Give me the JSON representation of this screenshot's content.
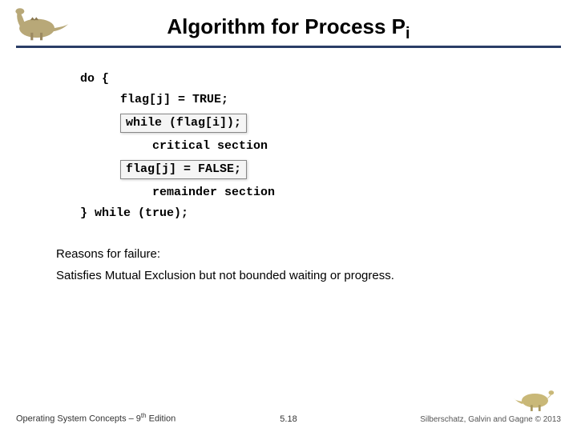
{
  "title_main": "Algorithm for Process P",
  "title_sub": "i",
  "code": {
    "l1": "do {",
    "l2": "flag[j] = TRUE;",
    "l3": "while (flag[i]);",
    "l4": "critical section",
    "l5": "flag[j] = FALSE;",
    "l6": "remainder section",
    "l7": "} while (true);"
  },
  "reasons_heading": "Reasons for failure:",
  "reasons_body": "Satisfies Mutual Exclusion but not bounded waiting or progress.",
  "footer": {
    "left_a": "Operating System Concepts – 9",
    "left_sup": "th",
    "left_b": " Edition",
    "center": "5.18",
    "right": "Silberschatz, Galvin and Gagne © 2013"
  }
}
